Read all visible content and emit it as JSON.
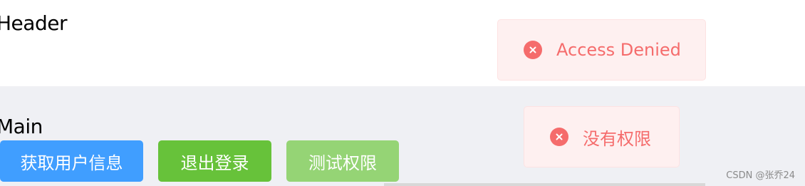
{
  "header": {
    "title": "Header"
  },
  "main": {
    "title": "Main",
    "buttons": {
      "get_user_info": "获取用户信息",
      "logout": "退出登录",
      "test_permission": "测试权限"
    }
  },
  "messages": [
    {
      "type": "error",
      "icon": "close-circle-icon",
      "text": "Access Denied"
    },
    {
      "type": "error",
      "icon": "close-circle-icon",
      "text": "没有权限"
    }
  ],
  "watermark": "CSDN @张乔24",
  "colors": {
    "primary": "#409eff",
    "success": "#67c23a",
    "success_light": "#95d475",
    "error": "#f56c6c",
    "error_bg": "#fef0f0",
    "main_bg": "#eff0f4"
  }
}
